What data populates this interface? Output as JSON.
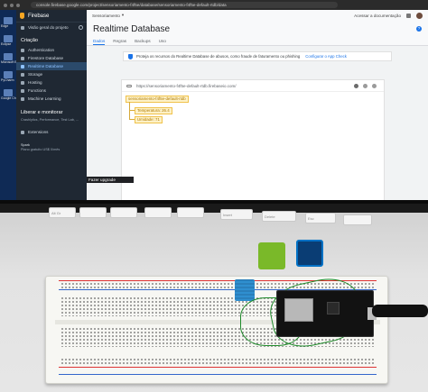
{
  "browser": {
    "url": "console.firebase.google.com/project/sensoriamento-f4f5e/database/sensoriamento-f4f5e-default-rtdb/data"
  },
  "desktop_icons": [
    "Edge",
    "Eclipse",
    "Microsoft Edge",
    "PyCharm",
    "Google Chrome"
  ],
  "sidebar": {
    "brand": "Firebase",
    "overview": "Visão geral do projeto",
    "section_build": "Criação",
    "items": [
      {
        "label": "Authentication",
        "active": false
      },
      {
        "label": "Firestore Database",
        "active": false
      },
      {
        "label": "Realtime Database",
        "active": true
      },
      {
        "label": "Storage",
        "active": false
      },
      {
        "label": "Hosting",
        "active": false
      },
      {
        "label": "Functions",
        "active": false
      },
      {
        "label": "Machine Learning",
        "active": false
      }
    ],
    "section_release": "Liberar e monitorar",
    "release_sub": "Crashlytics, Performance, Test Lab, ...",
    "extensions": "Extensions",
    "plan_name": "Spark",
    "plan_sub": "Plano gratuito US$ 0/mês",
    "upgrade": "Fazer upgrade"
  },
  "topbar": {
    "project": "Sensoriamento",
    "docs_link": "Acessar a documentação"
  },
  "page": {
    "title": "Realtime Database",
    "tabs": [
      {
        "label": "Dados",
        "active": true
      },
      {
        "label": "Regras",
        "active": false
      },
      {
        "label": "Backups",
        "active": false
      },
      {
        "label": "Uso",
        "active": false
      }
    ]
  },
  "banner": {
    "text": "Proteja os recursos do Realtime Database de abusos, como fraude de faturamento ou phishing",
    "link": "Configurar o App Check"
  },
  "database": {
    "url": "https://sensoriamento-f4f5e-default-rtdb.firebaseio.com/",
    "root_key": "sensoriamento-f4f5e-default-rtdb",
    "children": [
      {
        "key": "Temperatura",
        "value": "26.4"
      },
      {
        "key": "Umidade",
        "value": "71"
      }
    ]
  },
  "keyboard_keys": [
    "Alt Gr",
    "Insert",
    "Delete",
    "Esc"
  ],
  "stickers": {
    "nvidia_color": "#7ab929",
    "intel_color": "#0071c5"
  },
  "colors": {
    "firebase_accent": "#f6a623",
    "link_blue": "#1a73e8",
    "sidebar_bg": "#1f2833"
  }
}
